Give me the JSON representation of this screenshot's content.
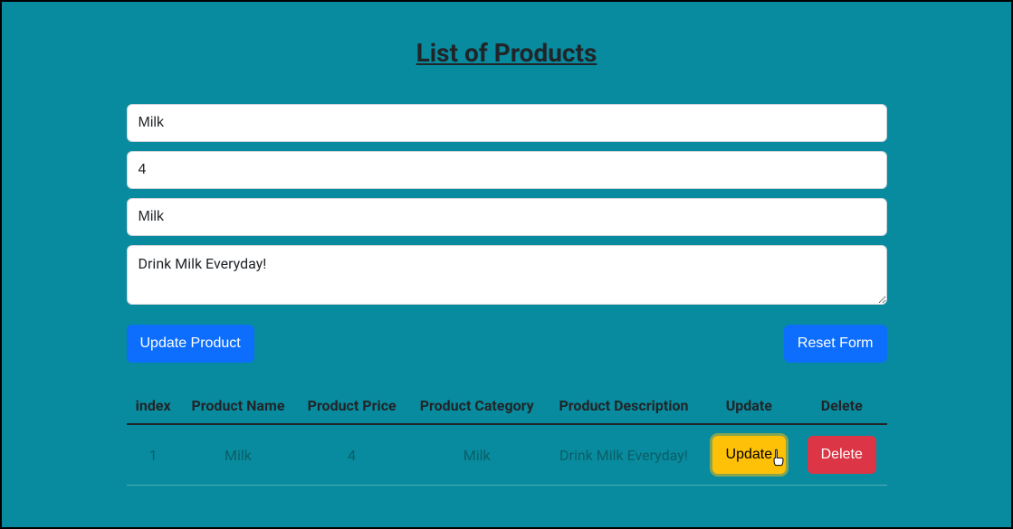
{
  "title": "List of Products",
  "form": {
    "name": "Milk",
    "price": "4",
    "category": "Milk",
    "description": "Drink Milk Everyday!"
  },
  "buttons": {
    "submit": "Update Product",
    "reset": "Reset Form"
  },
  "table": {
    "headers": [
      "index",
      "Product Name",
      "Product Price",
      "Product Category",
      "Product Description",
      "Update",
      "Delete"
    ],
    "rows": [
      {
        "index": "1",
        "name": "Milk",
        "price": "4",
        "category": "Milk",
        "description": "Drink Milk Everyday!",
        "update_label": "Update",
        "delete_label": "Delete"
      }
    ]
  }
}
